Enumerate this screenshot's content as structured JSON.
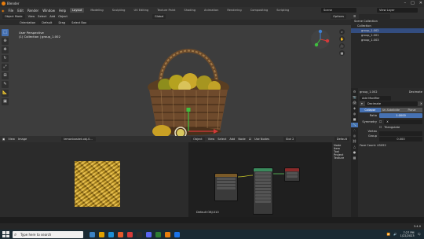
{
  "app": {
    "title": "Blender"
  },
  "menu": {
    "items": [
      "File",
      "Edit",
      "Render",
      "Window",
      "Help"
    ]
  },
  "workspaces": [
    "Layout",
    "Modeling",
    "Sculpting",
    "UV Editing",
    "Texture Paint",
    "Shading",
    "Animation",
    "Rendering",
    "Compositing",
    "Scripting"
  ],
  "scene": {
    "name": "Scene",
    "view_layer": "View Layer"
  },
  "viewport": {
    "mode": "Object Mode",
    "menus": [
      "View",
      "Select",
      "Add",
      "Object"
    ],
    "transform_orientation": "Orientation",
    "default_label": "Default",
    "drag_label": "Drag",
    "select_box": "Select Box",
    "global_label": "Global",
    "options_label": "Options",
    "info_line1": "User Perspective",
    "info_line2": "(1) Collection | group_1.002"
  },
  "outliner": {
    "rows": [
      {
        "label": "Scene Collection"
      },
      {
        "label": "Collection"
      },
      {
        "label": "group_1.002"
      },
      {
        "label": "group_1.001"
      },
      {
        "label": "group_1.003"
      }
    ]
  },
  "properties": {
    "object_name": "group_1.002",
    "modifier_name": "Decimate",
    "add_modifier": "Add Modifier",
    "mode_tabs": [
      "Collapse",
      "Un-Subdivide",
      "Planar"
    ],
    "ratio_label": "Ratio",
    "ratio_value": "1.0000",
    "symmetry_label": "Symmetry",
    "symmetry_axis": "X",
    "triangulate_label": "Triangulate",
    "vertex_group_label": "Vertex Group",
    "factor_value": "0.000",
    "face_count": "Face Count: 45092"
  },
  "image_editor": {
    "menus": [
      "View",
      "Image"
    ],
    "image_name": "lemonbasket.obj.0..."
  },
  "node_editor": {
    "object_label": "Object",
    "menus": [
      "View",
      "Select",
      "Add",
      "Node"
    ],
    "use_nodes_label": "Use Nodes",
    "slot_label": "Slot 2",
    "material_label": "Default",
    "material_footer": "Default OBJ.010",
    "side_tabs": [
      "Node",
      "Item",
      "Tool",
      "Project",
      "Texture"
    ]
  },
  "status": {
    "version": "3.4.0"
  },
  "taskbar": {
    "search_placeholder": "Type here to search",
    "time": "7:27 PM",
    "date": "1/22/2023"
  }
}
